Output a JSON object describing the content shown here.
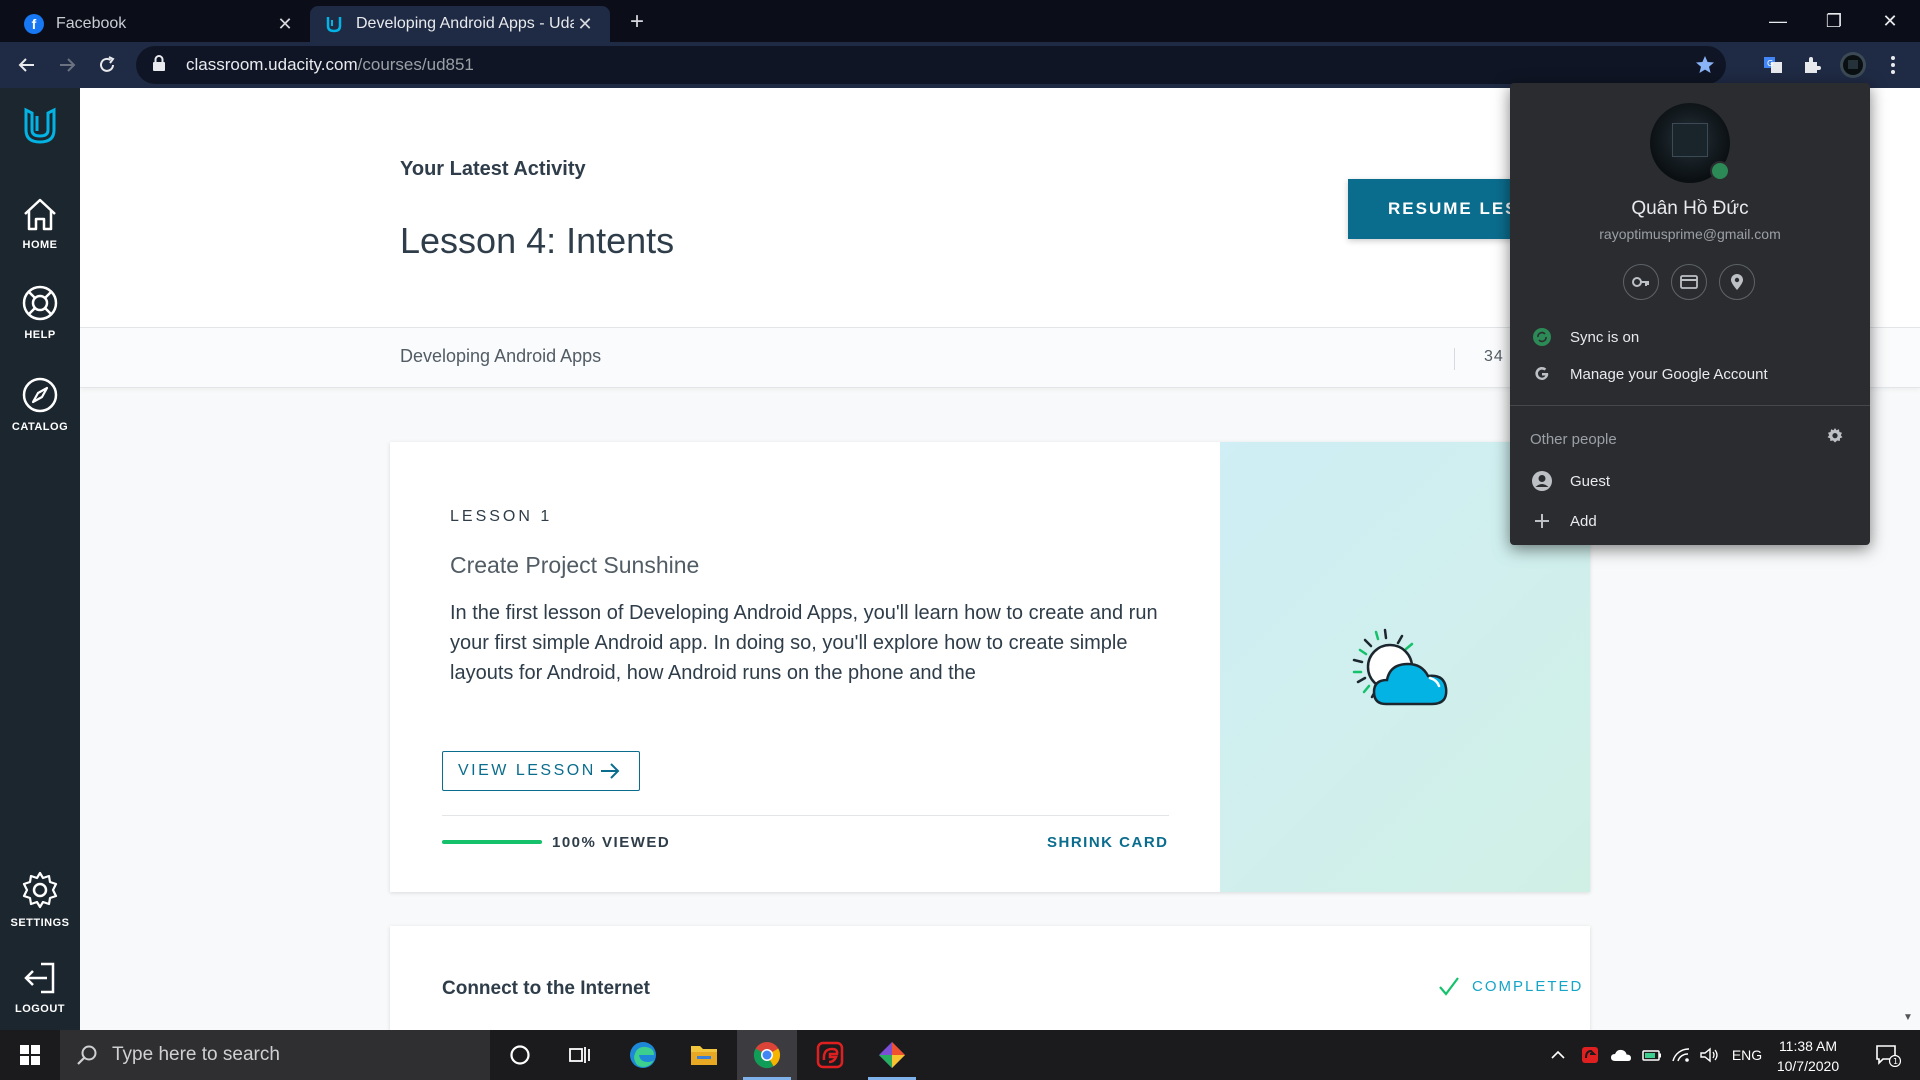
{
  "browser": {
    "tabs": [
      {
        "title": "Facebook",
        "favicon": "facebook-icon",
        "active": false
      },
      {
        "title": "Developing Android Apps - Udac",
        "favicon": "udacity-icon",
        "active": true
      }
    ],
    "url_host": "classroom.udacity.com",
    "url_path": "/courses/ud851",
    "colors": {
      "tabstrip": "#0b0d18",
      "toolbar": "#1f2a44",
      "star": "#8ab4f8"
    }
  },
  "sidebar": {
    "items": [
      {
        "label": "HOME",
        "icon": "home-icon"
      },
      {
        "label": "HELP",
        "icon": "lifebuoy-icon"
      },
      {
        "label": "CATALOG",
        "icon": "compass-icon"
      },
      {
        "label": "SETTINGS",
        "icon": "gear-icon"
      },
      {
        "label": "LOGOUT",
        "icon": "logout-icon"
      }
    ]
  },
  "header": {
    "latest_label": "Your Latest Activity",
    "lesson_title": "Lesson 4: Intents",
    "resume_label": "RESUME LESS"
  },
  "course_bar": {
    "course_name": "Developing Android Apps",
    "progress_text": "34"
  },
  "lesson_card": {
    "lesson_label": "LESSON 1",
    "title": "Create Project Sunshine",
    "description": "In the first lesson of Developing Android Apps, you'll learn how to create and run your first simple Android app. In doing so, you'll explore how to create simple layouts for Android, how Android runs on the phone and the",
    "view_label": "VIEW LESSON",
    "viewed_fraction": 1.0,
    "viewed_label": "100% VIEWED",
    "shrink_label": "SHRINK CARD",
    "illustration": "sun-cloud-icon"
  },
  "next_card": {
    "title": "Connect to the Internet",
    "status": "COMPLETED"
  },
  "profile_menu": {
    "name": "Quân Hồ Đức",
    "email": "rayoptimusprime@gmail.com",
    "quick_icons": [
      "key-icon",
      "card-icon",
      "location-pin-icon"
    ],
    "sync_label": "Sync is on",
    "manage_label": "Manage your Google Account",
    "other_people_label": "Other people",
    "guest_label": "Guest",
    "add_label": "Add"
  },
  "taskbar": {
    "search_placeholder": "Type here to search",
    "language": "ENG",
    "time": "11:38 AM",
    "date": "10/7/2020",
    "notification_count": "1",
    "apps": [
      "cortana-icon",
      "task-view-icon",
      "edge-icon",
      "file-explorer-icon",
      "chrome-icon",
      "garena-icon",
      "git-icon"
    ]
  }
}
